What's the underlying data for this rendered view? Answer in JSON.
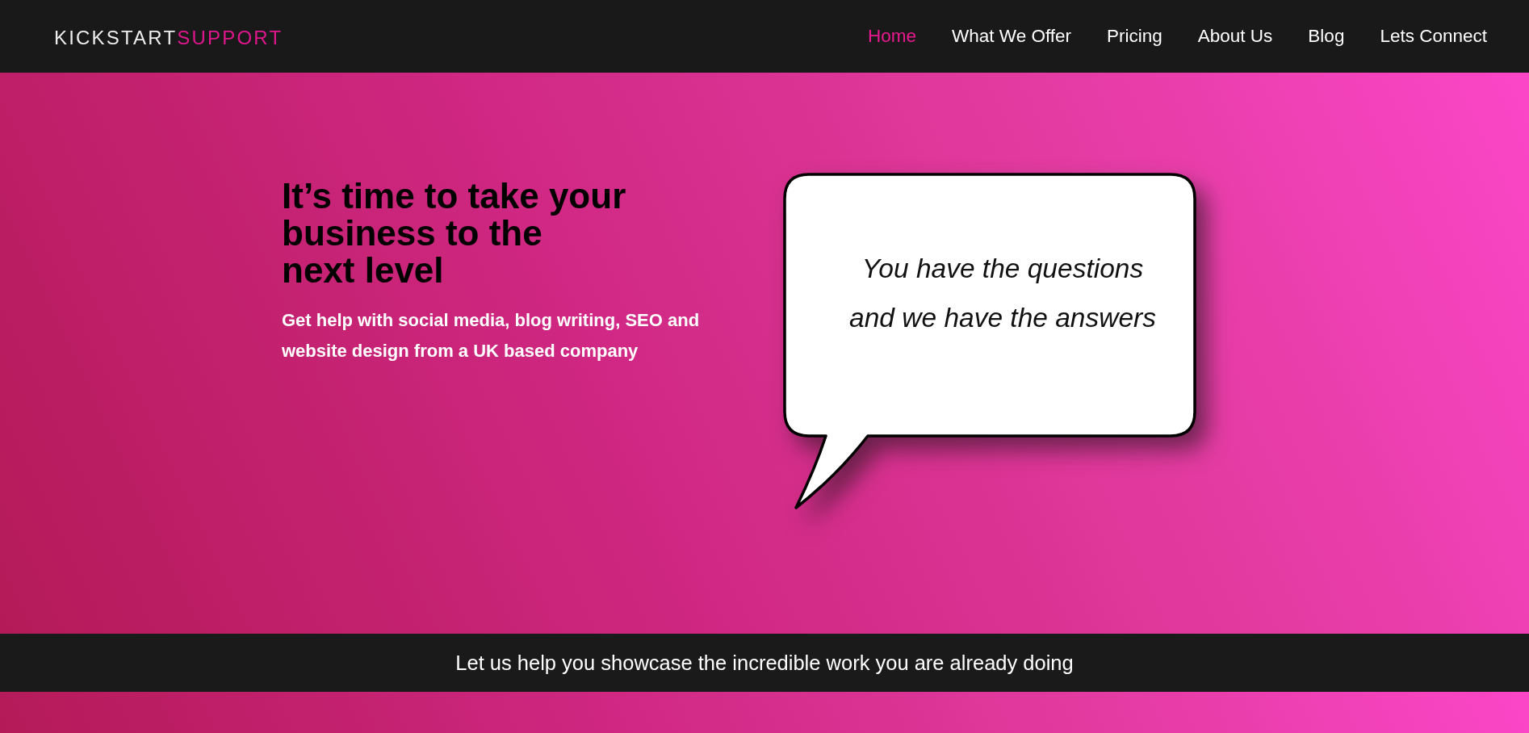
{
  "header": {
    "logo": [
      {
        "text": "KICKSTART",
        "kind": "plain"
      },
      {
        "text": "SUPPORT",
        "kind": "accent"
      }
    ],
    "nav": [
      {
        "label": "Home",
        "selected": true
      },
      {
        "label": "What We Offer",
        "selected": false
      },
      {
        "label": "Pricing",
        "selected": false
      },
      {
        "label": "About Us",
        "selected": false
      },
      {
        "label": "Blog",
        "selected": false
      },
      {
        "label": "Lets Connect",
        "selected": false
      }
    ]
  },
  "hero": {
    "headline": [
      "It’s time to take your",
      "business to the",
      "next level"
    ],
    "subheading": "Get help with social media, blog writing, SEO and website design from a UK based company",
    "speech_bubble": [
      "You have the questions",
      "and we have the answers"
    ]
  },
  "banner": {
    "text": "Let us help you showcase the incredible work you are already doing"
  }
}
